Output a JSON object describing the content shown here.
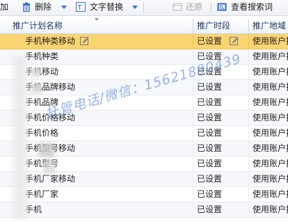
{
  "toolbar": {
    "add_label": "加",
    "delete_label": "删除",
    "text_replace_label": "文字替换",
    "restore_label": "还原",
    "search_terms_label": "查看搜索词"
  },
  "table": {
    "columns": [
      "推广计划名称",
      "推广时段",
      "推广地域"
    ],
    "rows": [
      {
        "name": "手机种类移动",
        "time": "已设置",
        "region": "使用账户推广地域",
        "selected": true
      },
      {
        "name": "手机种类",
        "time": "已设置",
        "region": "使用账户推广地域"
      },
      {
        "name": "手机移动",
        "time": "已设置",
        "region": "使用账户推广地域"
      },
      {
        "name": "手机品牌移动",
        "time": "已设置",
        "region": "使用账户推广地域"
      },
      {
        "name": "手机品牌",
        "time": "已设置",
        "region": "使用账户推广地域"
      },
      {
        "name": "手机价格移动",
        "time": "已设置",
        "region": "使用账户推广地域"
      },
      {
        "name": "手机价格",
        "time": "已设置",
        "region": "使用账户推广地域"
      },
      {
        "name": "手机型号移动",
        "time": "已设置",
        "region": "使用账户推广地域"
      },
      {
        "name": "手机型号",
        "time": "已设置",
        "region": "使用账户推广地域"
      },
      {
        "name": "手机厂家移动",
        "time": "已设置",
        "region": "使用账户推广地域"
      },
      {
        "name": "手机厂家",
        "time": "已设置",
        "region": "使用账户推广地域"
      },
      {
        "name": "手机",
        "time": "已设置",
        "region": "使用账户推广地域"
      }
    ]
  },
  "watermark": {
    "line1": "托管电话/微信：",
    "line2": "15621890439"
  },
  "colors": {
    "selected_row": "#fbd472",
    "header_text": "#1f3864",
    "watermark": "#4678d7"
  }
}
